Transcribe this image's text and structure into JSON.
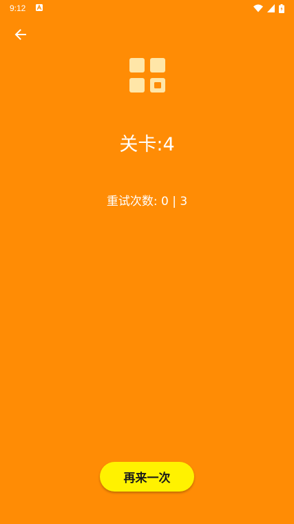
{
  "status_bar": {
    "time": "9:12",
    "icons": [
      "notification-a-icon",
      "wifi-icon",
      "signal-icon",
      "battery-icon"
    ]
  },
  "toolbar": {
    "back_icon": "arrow-back-icon"
  },
  "header": {
    "icon": "grid-blocks-icon",
    "level_label": "关卡:4"
  },
  "retry": {
    "label": "重试次数:",
    "used": "0",
    "separator": "|",
    "total": "3"
  },
  "actions": {
    "again_label": "再来一次"
  },
  "colors": {
    "background": "#FF8C05",
    "button": "#FFF200",
    "icon_tile": "#FFE6A8"
  }
}
